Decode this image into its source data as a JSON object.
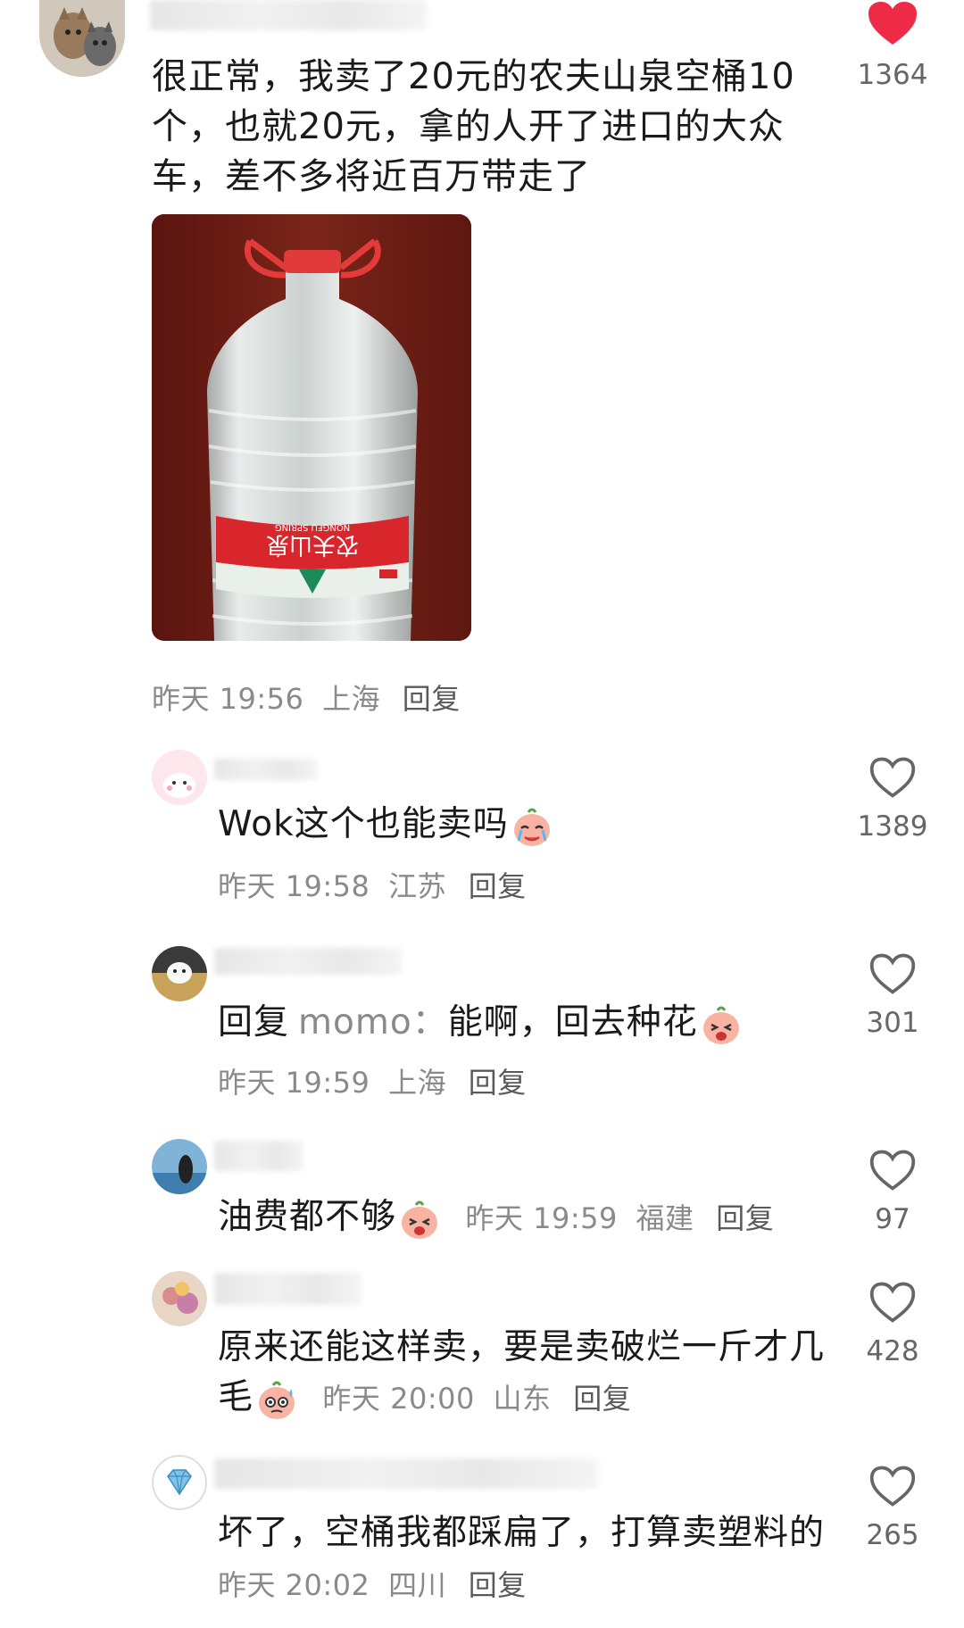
{
  "main_comment": {
    "text": "很正常，我卖了20元的农夫山泉空桶10个，也就20元，拿的人开了进口的大众车，差不多将近百万带走了",
    "time": "昨天 19:56",
    "location": "上海",
    "reply_label": "回复",
    "likes": "1364",
    "liked": true,
    "image": {
      "label_brand": "农夫山泉",
      "label_brand_en": "NONGFU SPRING"
    }
  },
  "comments": [
    {
      "text": "Wok这个也能卖吗",
      "emoji": "crying-face-emoji",
      "time": "昨天 19:58",
      "location": "江苏",
      "reply_label": "回复",
      "likes": "1389"
    },
    {
      "reply_prefix": "回复",
      "reply_target": "momo：",
      "text": "能啊，回去种花",
      "emoji": "laughing-face-emoji",
      "time": "昨天 19:59",
      "location": "上海",
      "reply_label": "回复",
      "likes": "301"
    },
    {
      "text": "油费都不够",
      "emoji": "laughing-face-emoji",
      "time": "昨天 19:59",
      "location": "福建",
      "reply_label": "回复",
      "likes": "97"
    },
    {
      "text": "原来还能这样卖，要是卖破烂一斤才几毛",
      "emoji": "sweat-face-emoji",
      "time": "昨天 20:00",
      "location": "山东",
      "reply_label": "回复",
      "likes": "428"
    },
    {
      "text": "坏了，空桶我都踩扁了，打算卖塑料的",
      "time": "昨天 20:02",
      "location": "四川",
      "reply_label": "回复",
      "likes": "265"
    }
  ],
  "colors": {
    "liked_heart": "#ee2b47",
    "meta_gray": "#8a8a8a",
    "label_red": "#d8262c"
  }
}
